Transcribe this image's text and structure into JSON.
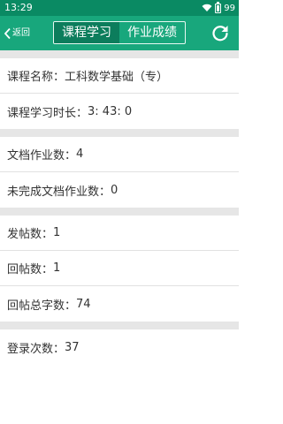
{
  "status_bar": {
    "time": "13:29",
    "battery_level": "99",
    "wifi_icon": "wifi-icon",
    "battery_icon": "battery-icon"
  },
  "nav": {
    "back_label": "返回",
    "back_icon": "chevron-left-icon",
    "tabs": [
      {
        "label": "课程学习",
        "active": true
      },
      {
        "label": "作业成绩",
        "active": false
      }
    ],
    "refresh_icon": "refresh-icon"
  },
  "colors": {
    "status_bar": "#0a8a63",
    "nav_bar": "#18a77c",
    "active_tab": "#0c7d5c",
    "separator": "#e6e6e6"
  },
  "sections": [
    {
      "rows": [
        {
          "label": "课程名称：",
          "value": "工科数学基础（专）"
        },
        {
          "label": "课程学习时长：",
          "value": "3: 43: 0"
        }
      ]
    },
    {
      "rows": [
        {
          "label": "文档作业数：",
          "value": "4"
        },
        {
          "label": "未完成文档作业数：",
          "value": "0"
        }
      ]
    },
    {
      "rows": [
        {
          "label": "发帖数：",
          "value": "1"
        },
        {
          "label": "回帖数：",
          "value": "1"
        },
        {
          "label": "回帖总字数：",
          "value": "74"
        }
      ]
    },
    {
      "rows": [
        {
          "label": "登录次数：",
          "value": "37"
        }
      ]
    }
  ]
}
